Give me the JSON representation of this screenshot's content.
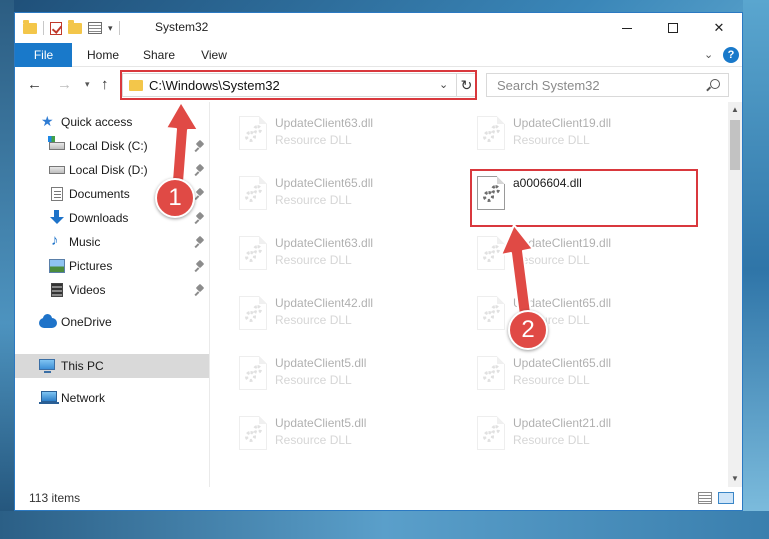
{
  "window": {
    "title": "System32",
    "controls": {
      "minimize": "",
      "maximize": "",
      "close": "✕"
    }
  },
  "ribbon": {
    "tabs": [
      "File",
      "Home",
      "Share",
      "View"
    ],
    "help": "?"
  },
  "address": {
    "path": "C:\\Windows\\System32",
    "search_placeholder": "Search System32"
  },
  "nav": {
    "items": [
      {
        "label": "Quick access",
        "icon": "star-icon"
      },
      {
        "label": "Local Disk (C:)",
        "icon": "drive-icon",
        "pinned": true
      },
      {
        "label": "Local Disk (D:)",
        "icon": "drive-icon",
        "pinned": true
      },
      {
        "label": "Documents",
        "icon": "documents-icon",
        "pinned": true
      },
      {
        "label": "Downloads",
        "icon": "downloads-icon",
        "pinned": true
      },
      {
        "label": "Music",
        "icon": "music-icon",
        "pinned": true
      },
      {
        "label": "Pictures",
        "icon": "pictures-icon",
        "pinned": true
      },
      {
        "label": "Videos",
        "icon": "videos-icon",
        "pinned": true
      },
      {
        "label": "OneDrive",
        "icon": "onedrive-icon"
      },
      {
        "label": "This PC",
        "icon": "this-pc-icon",
        "selected": true
      },
      {
        "label": "Network",
        "icon": "network-icon"
      }
    ]
  },
  "files": {
    "left": [
      {
        "name": "UpdateClient63.dll",
        "type": "Resource DLL"
      },
      {
        "name": "UpdateClient65.dll",
        "type": "Resource DLL"
      },
      {
        "name": "UpdateClient63.dll",
        "type": "Resource DLL"
      },
      {
        "name": "UpdateClient42.dll",
        "type": "Resource DLL"
      },
      {
        "name": "UpdateClient5.dll",
        "type": "Resource DLL"
      },
      {
        "name": "UpdateClient5.dll",
        "type": "Resource DLL"
      }
    ],
    "right": [
      {
        "name": "UpdateClient19.dll",
        "type": "Resource DLL"
      },
      {
        "name": "a0006604.dll",
        "type": "",
        "highlight": true
      },
      {
        "name": "UpdateClient19.dll",
        "type": "Resource DLL"
      },
      {
        "name": "UpdateClient65.dll",
        "type": "Resource DLL"
      },
      {
        "name": "UpdateClient65.dll",
        "type": "Resource DLL"
      },
      {
        "name": "UpdateClient21.dll",
        "type": "Resource DLL"
      }
    ]
  },
  "status": {
    "item_count": "113 items"
  },
  "annotations": {
    "badge1": "1",
    "badge2": "2",
    "color": "#e04a45"
  }
}
